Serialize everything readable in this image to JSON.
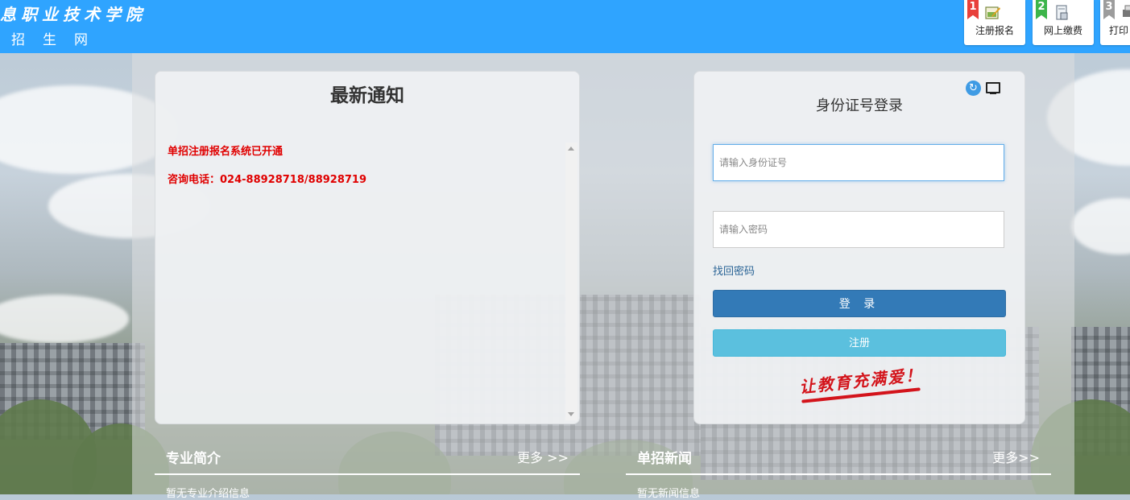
{
  "header": {
    "brand_line1": "息职业技术学院",
    "brand_line2": "招生网",
    "buttons": [
      {
        "number": "1",
        "label": "注册报名",
        "color": "#e8403b",
        "icon": "register-icon"
      },
      {
        "number": "2",
        "label": "网上缴费",
        "color": "#3cb54a",
        "icon": "payment-icon"
      },
      {
        "number": "3",
        "label": "打印",
        "color": "#9c9c9c",
        "icon": "print-icon"
      }
    ]
  },
  "notice": {
    "title": "最新通知",
    "items": [
      "单招注册报名系统已开通",
      "咨询电话：024-88928718/88928719"
    ]
  },
  "login": {
    "title": "身份证号登录",
    "id_placeholder": "请输入身份证号",
    "password_placeholder": "请输入密码",
    "forgot": "找回密码",
    "login_button": "登 录",
    "register_button": "注册",
    "slogan": "让教育充满爱！"
  },
  "sections": {
    "majors": {
      "title": "专业简介",
      "more": "更多 >>",
      "empty": "暂无专业介绍信息"
    },
    "news": {
      "title": "单招新闻",
      "more": "更多>>",
      "empty": "暂无新闻信息"
    }
  },
  "colors": {
    "header": "#2fa4ff",
    "primary": "#337ab7",
    "info": "#5bc0de",
    "notice_red": "#e00000"
  }
}
